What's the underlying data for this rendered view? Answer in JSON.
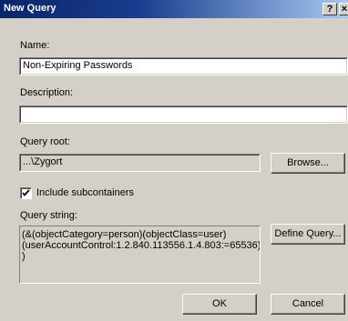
{
  "window": {
    "title": "New Query",
    "help_label": "?",
    "close_label": "×"
  },
  "name": {
    "label": "Name:",
    "value": "Non-Expiring Passwords"
  },
  "description": {
    "label": "Description:",
    "value": ""
  },
  "query_root": {
    "label": "Query root:",
    "value": "...\\Zygort",
    "browse_label": "Browse..."
  },
  "include_subcontainers": {
    "label": "Include subcontainers",
    "checked": true
  },
  "query_string": {
    "label": "Query string:",
    "lines": [
      "(&(objectCategory=person)(objectClass=user)",
      "(userAccountControl:1.2.840.113556.1.4.803:=65536)",
      ")"
    ],
    "define_label": "Define Query..."
  },
  "buttons": {
    "ok_label": "OK",
    "cancel_label": "Cancel"
  }
}
